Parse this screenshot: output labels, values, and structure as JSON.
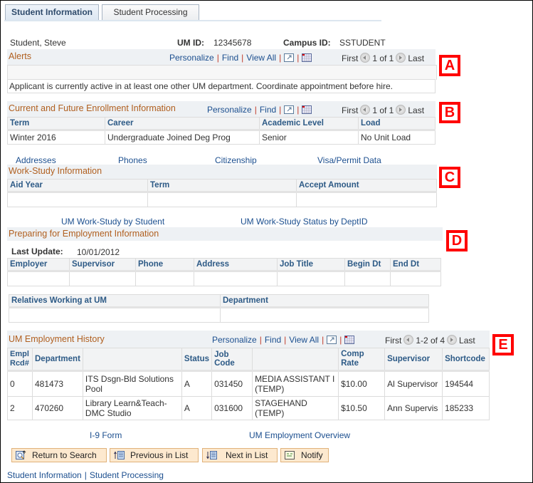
{
  "tabs": [
    {
      "label": "Student Information",
      "active": true
    },
    {
      "label": "Student Processing",
      "active": false
    }
  ],
  "student": {
    "name": "Student, Steve",
    "um_id_label": "UM ID:",
    "um_id": "12345678",
    "campus_id_label": "Campus ID:",
    "campus_id": "SSTUDENT"
  },
  "nav": {
    "personalize": "Personalize",
    "find": "Find",
    "view_all": "View All",
    "first": "First",
    "last": "Last"
  },
  "alerts": {
    "title": "Alerts",
    "range": "1 of 1",
    "message": "Applicant is currently active in at least one other UM department. Coordinate appointment before hire."
  },
  "enrollment": {
    "title": "Current and Future Enrollment Information",
    "range": "1 of 1",
    "columns": [
      "Term",
      "Career",
      "Academic Level",
      "Load"
    ],
    "rows": [
      [
        "Winter 2016",
        "Undergraduate Joined Deg Prog",
        "Senior",
        "No Unit Load"
      ]
    ]
  },
  "links_row1": [
    "Addresses",
    "Phones",
    "Citizenship",
    "Visa/Permit Data"
  ],
  "work_study": {
    "title": "Work-Study Information",
    "columns": [
      "Aid Year",
      "Term",
      "Accept Amount"
    ]
  },
  "links_row2": [
    "UM Work-Study by Student",
    "UM Work-Study Status by DeptID"
  ],
  "prep_employment": {
    "title": "Preparing for Employment Information",
    "last_update_label": "Last Update:",
    "last_update": "10/01/2012",
    "columns": [
      "Employer",
      "Supervisor",
      "Phone",
      "Address",
      "Job Title",
      "Begin Dt",
      "End Dt"
    ]
  },
  "relatives": {
    "columns": [
      "Relatives Working at UM",
      "Department"
    ]
  },
  "employment_history": {
    "title": "UM Employment History",
    "range": "1-2 of 4",
    "columns": [
      "Empl Rcd#",
      "Department",
      "",
      "Status",
      "Job Code",
      "",
      "Comp Rate",
      "Supervisor",
      "Shortcode"
    ],
    "rows": [
      [
        "0",
        "481473",
        "ITS Dsgn-Bld Solutions Pool",
        "A",
        "031450",
        "MEDIA ASSISTANT I (TEMP)",
        "$10.00",
        "Al Supervisor",
        "194544"
      ],
      [
        "2",
        "470260",
        "Library Learn&Teach-DMC Studio",
        "A",
        "031600",
        "STAGEHAND (TEMP)",
        "$10.50",
        "Ann Supervis",
        "185233"
      ]
    ]
  },
  "links_row3": [
    "I-9 Form",
    "UM Employment Overview"
  ],
  "buttons": {
    "return_to_search": "Return to Search",
    "previous_in_list": "Previous in List",
    "next_in_list": "Next in List",
    "notify": "Notify"
  },
  "footer_links": [
    "Student Information",
    "Student Processing"
  ],
  "markers": [
    "A",
    "B",
    "C",
    "D",
    "E"
  ]
}
